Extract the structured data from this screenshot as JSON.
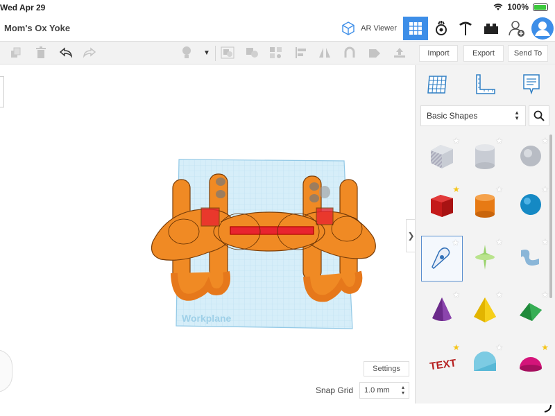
{
  "status": {
    "time": "Wed Apr 29",
    "battery": "100%",
    "battery_level": 1.0
  },
  "header": {
    "title": "Mom's Ox Yoke",
    "ar_viewer": "AR Viewer"
  },
  "toolbar": {
    "import": "Import",
    "export": "Export",
    "send_to": "Send To"
  },
  "canvas": {
    "workplane_label": "Workplane",
    "settings": "Settings",
    "snap_grid_label": "Snap Grid",
    "snap_grid_value": "1.0 mm"
  },
  "sidebar": {
    "shape_category": "Basic Shapes",
    "shapes": [
      {
        "name": "Box (hole)",
        "starred": false
      },
      {
        "name": "Cylinder (hole)",
        "starred": false
      },
      {
        "name": "Sphere (hole)",
        "starred": false
      },
      {
        "name": "Box",
        "starred": true
      },
      {
        "name": "Cylinder",
        "starred": false
      },
      {
        "name": "Sphere",
        "starred": false
      },
      {
        "name": "Scribble",
        "starred": false
      },
      {
        "name": "Paraboloid",
        "starred": false
      },
      {
        "name": "Shape Generator",
        "starred": false
      },
      {
        "name": "Cone",
        "starred": false
      },
      {
        "name": "Pyramid",
        "starred": false
      },
      {
        "name": "Roof",
        "starred": false
      },
      {
        "name": "Text",
        "starred": true
      },
      {
        "name": "Half Cylinder",
        "starred": false
      },
      {
        "name": "Half Sphere",
        "starred": true
      }
    ]
  },
  "colors": {
    "accent": "#3d8ee8",
    "model": "#f08a24",
    "highlight": "#e8242f",
    "workplane": "#cfe8f5"
  }
}
